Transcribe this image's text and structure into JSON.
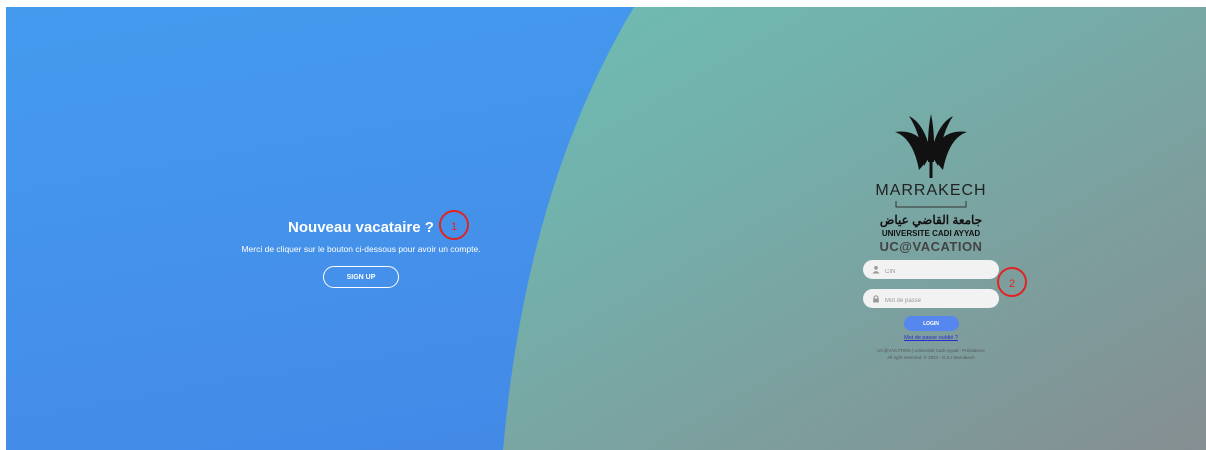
{
  "left_panel": {
    "title": "Nouveau vacataire ?",
    "text": "Merci de cliquer sur le bouton ci-dessous pour avoir un compte.",
    "signup_label": "SIGN UP"
  },
  "markers": [
    "1",
    "2"
  ],
  "right_panel": {
    "logo": {
      "city": "MARRAKECH",
      "arabic": "جامعة القاضي عياض",
      "university": "UNIVERSITE CADI AYYAD"
    },
    "app_name": "UC@VACATION",
    "cin_placeholder": "CIN",
    "password_placeholder": "Mot de passe",
    "login_label": "LOGIN",
    "forgot_password": "Mot de passe oublié ?",
    "footer_line1": "UC@VACATION | Université Cadi Ayyad - Présidence",
    "footer_line2": "All right reserved. © 2023 - D.S.I Marrakech"
  },
  "icons": {
    "user": "user-icon",
    "lock": "lock-icon",
    "logo": "palm-logo-icon"
  },
  "colors": {
    "blue_panel": "#4490ea",
    "green_panel": "#66c9b9",
    "marker": "#e02323",
    "login_button": "#5587ee"
  }
}
